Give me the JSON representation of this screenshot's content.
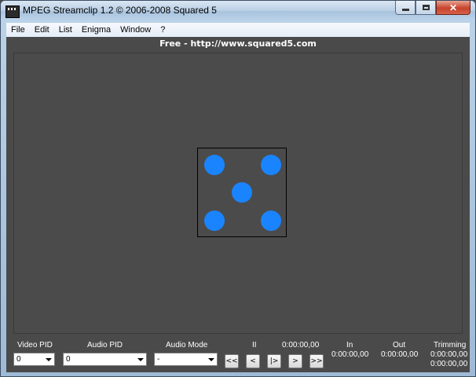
{
  "window": {
    "title": "MPEG Streamclip 1.2  ©  2006-2008 Squared 5",
    "close_glyph": "✕"
  },
  "menu": [
    "File",
    "Edit",
    "List",
    "Enigma",
    "Window",
    "?"
  ],
  "banner": "Free  -  http://www.squared5.com",
  "dice": {
    "pip_color": "#1a84ff",
    "pips": 5
  },
  "controls": {
    "video_pid": {
      "label": "Video PID",
      "value": "0"
    },
    "audio_pid": {
      "label": "Audio PID",
      "value": "0"
    },
    "audio_mode": {
      "label": "Audio Mode",
      "value": "-"
    },
    "pause_label": "II",
    "time": "0:00:00,00",
    "in": {
      "label": "In",
      "value": "0:00:00,00"
    },
    "out": {
      "label": "Out",
      "value": "0:00:00,00"
    },
    "trimming": {
      "label": "Trimming",
      "value1": "0:00:00,00",
      "value2": "0:00:00,00"
    },
    "buttons": [
      "<<",
      "<",
      "|>",
      ">",
      ">>"
    ]
  }
}
